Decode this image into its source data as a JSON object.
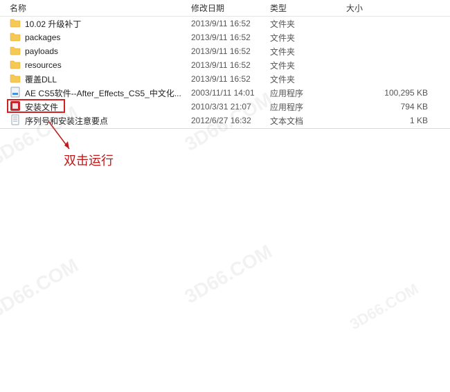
{
  "columns": {
    "name": "名称",
    "date": "修改日期",
    "type": "类型",
    "size": "大小"
  },
  "files": [
    {
      "icon": "folder",
      "name": "10.02 升级补丁",
      "date": "2013/9/11 16:52",
      "type": "文件夹",
      "size": ""
    },
    {
      "icon": "folder",
      "name": "packages",
      "date": "2013/9/11 16:52",
      "type": "文件夹",
      "size": ""
    },
    {
      "icon": "folder",
      "name": "payloads",
      "date": "2013/9/11 16:52",
      "type": "文件夹",
      "size": ""
    },
    {
      "icon": "folder",
      "name": "resources",
      "date": "2013/9/11 16:52",
      "type": "文件夹",
      "size": ""
    },
    {
      "icon": "folder",
      "name": "覆盖DLL",
      "date": "2013/9/11 16:52",
      "type": "文件夹",
      "size": ""
    },
    {
      "icon": "exe-generic",
      "name": "AE CS5软件--After_Effects_CS5_中文化...",
      "date": "2003/11/11 14:01",
      "type": "应用程序",
      "size": "100,295 KB"
    },
    {
      "icon": "exe-adobe",
      "name": "安装文件",
      "date": "2010/3/31 21:07",
      "type": "应用程序",
      "size": "794 KB"
    },
    {
      "icon": "txt",
      "name": "序列号和安装注意要点",
      "date": "2012/6/27 16:32",
      "type": "文本文档",
      "size": "1 KB"
    }
  ],
  "annotation": {
    "text": "双击运行"
  },
  "highlight_index": 6,
  "colors": {
    "folder": "#f6c957",
    "folder_dark": "#d9a420",
    "adobe": "#c8232c",
    "highlight": "#d02020"
  }
}
